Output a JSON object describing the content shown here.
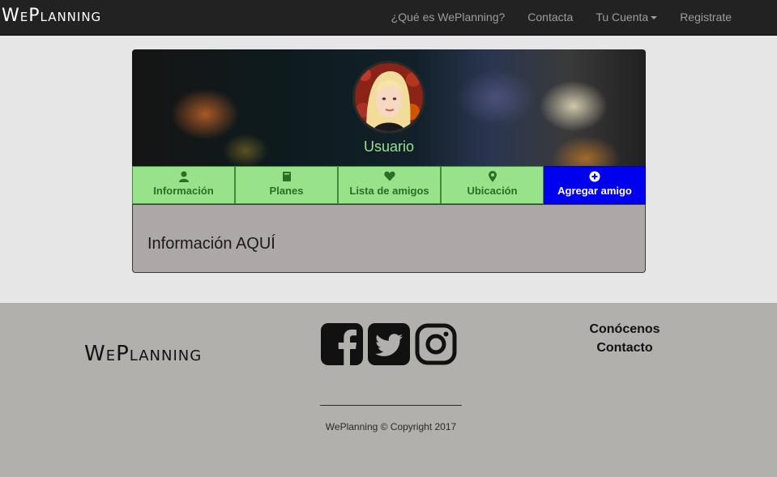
{
  "navbar": {
    "brand": "WePlanning",
    "links": [
      {
        "label": "¿Qué es WePlanning?"
      },
      {
        "label": "Contacta"
      },
      {
        "label": "Tu Cuenta"
      },
      {
        "label": "Registrate"
      }
    ]
  },
  "profile": {
    "username": "Usuario",
    "tabs": [
      {
        "label": "Información",
        "icon": "user-icon"
      },
      {
        "label": "Planes",
        "icon": "book-icon"
      },
      {
        "label": "Lista de amigos",
        "icon": "heart-icon"
      },
      {
        "label": "Ubicación",
        "icon": "map-marker-icon"
      },
      {
        "label": "Agregar amigo",
        "icon": "plus-circle-icon"
      }
    ],
    "info_text": "Información AQUÍ"
  },
  "footer": {
    "brand": "WePlanning",
    "social": [
      "facebook-icon",
      "twitter-icon",
      "instagram-icon"
    ],
    "links": [
      {
        "label": "Conócenos"
      },
      {
        "label": "Contacto"
      }
    ],
    "copyright": "WePlanning © Copyright 2017"
  },
  "colors": {
    "navbar_bg": "#222222",
    "tab_green": "#98e28a",
    "tab_text": "#2b6e28",
    "add_button": "#0000ee",
    "username": "#98e28a",
    "panel_bg": "#aea7a7",
    "footer_bg": "#b1b0ad"
  }
}
